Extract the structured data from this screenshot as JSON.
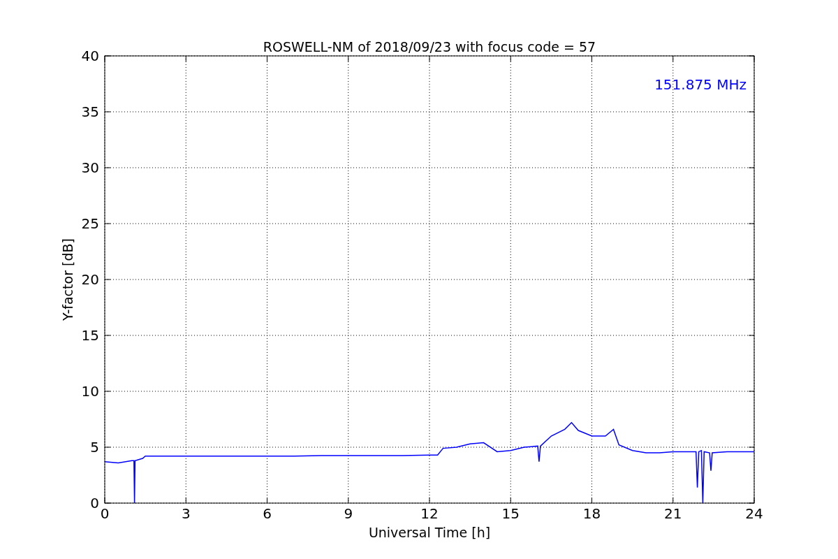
{
  "figure": {
    "chart_data": {
      "type": "line",
      "title": "ROSWELL-NM of 2018/09/23 with focus code = 57",
      "xlabel": "Universal Time [h]",
      "ylabel": "Y-factor [dB]",
      "x": [
        0,
        0.5,
        1.0,
        1.08,
        1.1,
        1.12,
        1.4,
        1.5,
        2,
        3,
        4,
        5,
        6,
        7,
        8,
        9,
        10,
        11,
        12,
        12.3,
        12.5,
        13,
        13.5,
        14,
        14.5,
        15,
        15.5,
        16,
        16.05,
        16.1,
        16.5,
        17,
        17.25,
        17.5,
        18,
        18.5,
        18.8,
        19,
        19.5,
        20,
        20.5,
        21,
        21.5,
        21.85,
        21.9,
        21.95,
        22.05,
        22.1,
        22.15,
        22.35,
        22.4,
        22.45,
        23,
        23.5,
        24
      ],
      "series": [
        {
          "name": "151.875 MHz",
          "color": "#0000ff",
          "values": [
            3.7,
            3.6,
            3.8,
            3.8,
            0,
            3.8,
            4.0,
            4.2,
            4.2,
            4.2,
            4.2,
            4.2,
            4.2,
            4.2,
            4.25,
            4.25,
            4.25,
            4.25,
            4.3,
            4.3,
            4.9,
            5.0,
            5.3,
            5.4,
            4.6,
            4.7,
            5.0,
            5.1,
            3.7,
            5.1,
            6.0,
            6.6,
            7.2,
            6.5,
            6.0,
            6.0,
            6.6,
            5.2,
            4.7,
            4.5,
            4.5,
            4.6,
            4.6,
            4.6,
            1.4,
            4.6,
            4.7,
            0,
            4.6,
            4.5,
            2.9,
            4.5,
            4.6,
            4.6,
            4.6
          ]
        }
      ],
      "xlim": [
        0,
        24
      ],
      "ylim": [
        0,
        40
      ],
      "xticks": [
        0,
        3,
        6,
        9,
        12,
        15,
        18,
        21,
        24
      ],
      "yticks": [
        0,
        5,
        10,
        15,
        20,
        25,
        30,
        35,
        40
      ],
      "grid": true
    }
  }
}
